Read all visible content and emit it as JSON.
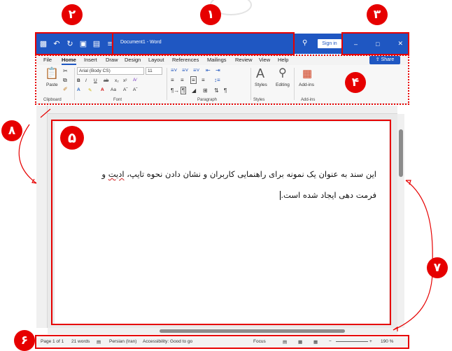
{
  "titlebar": {
    "qat_icons": [
      "save-icon",
      "undo-icon",
      "redo-icon",
      "save-alt-icon",
      "open-icon",
      "customize-icon"
    ],
    "document_title": "Document1 - Word",
    "signin_label": "Sign in",
    "window_controls": [
      "–",
      "□",
      "✕"
    ]
  },
  "tabs": {
    "items": [
      "File",
      "Home",
      "Insert",
      "Draw",
      "Design",
      "Layout",
      "References",
      "Mailings",
      "Review",
      "View",
      "Help"
    ],
    "active": "Home",
    "share_label": "Share"
  },
  "ribbon": {
    "clipboard": {
      "paste_label": "Paste",
      "group_label": "Clipboard"
    },
    "font": {
      "font_name": "Arial (Body CS)",
      "font_size": "11",
      "group_label": "Font",
      "format_buttons": [
        "B",
        "I",
        "U",
        "ab",
        "x₂",
        "x²"
      ],
      "case_label": "Aa"
    },
    "paragraph": {
      "group_label": "Paragraph"
    },
    "styles": {
      "label": "Styles",
      "group_label": "Styles"
    },
    "editing": {
      "label": "Editing"
    },
    "addins": {
      "label": "Add-ins",
      "group_label": "Add-ins"
    }
  },
  "document": {
    "line1_prefix": "این سند به عنوان یک نمونه برای راهنمایی کاربران و نشان دادن نحوه تایپ، ",
    "line1_misspelled": "ادیت",
    "line1_suffix": " و",
    "line2": "فرمت دهی ایجاد شده است."
  },
  "status": {
    "page": "Page 1 of 1",
    "words": "21 words",
    "language": "Persian (Iran)",
    "accessibility": "Accessibility: Good to go",
    "focus": "Focus",
    "zoom": "190 %"
  },
  "annotations": {
    "badges": [
      "۱",
      "۲",
      "۳",
      "۴",
      "۵",
      "۶",
      "۷",
      "۸"
    ],
    "accent": "#e60000"
  }
}
